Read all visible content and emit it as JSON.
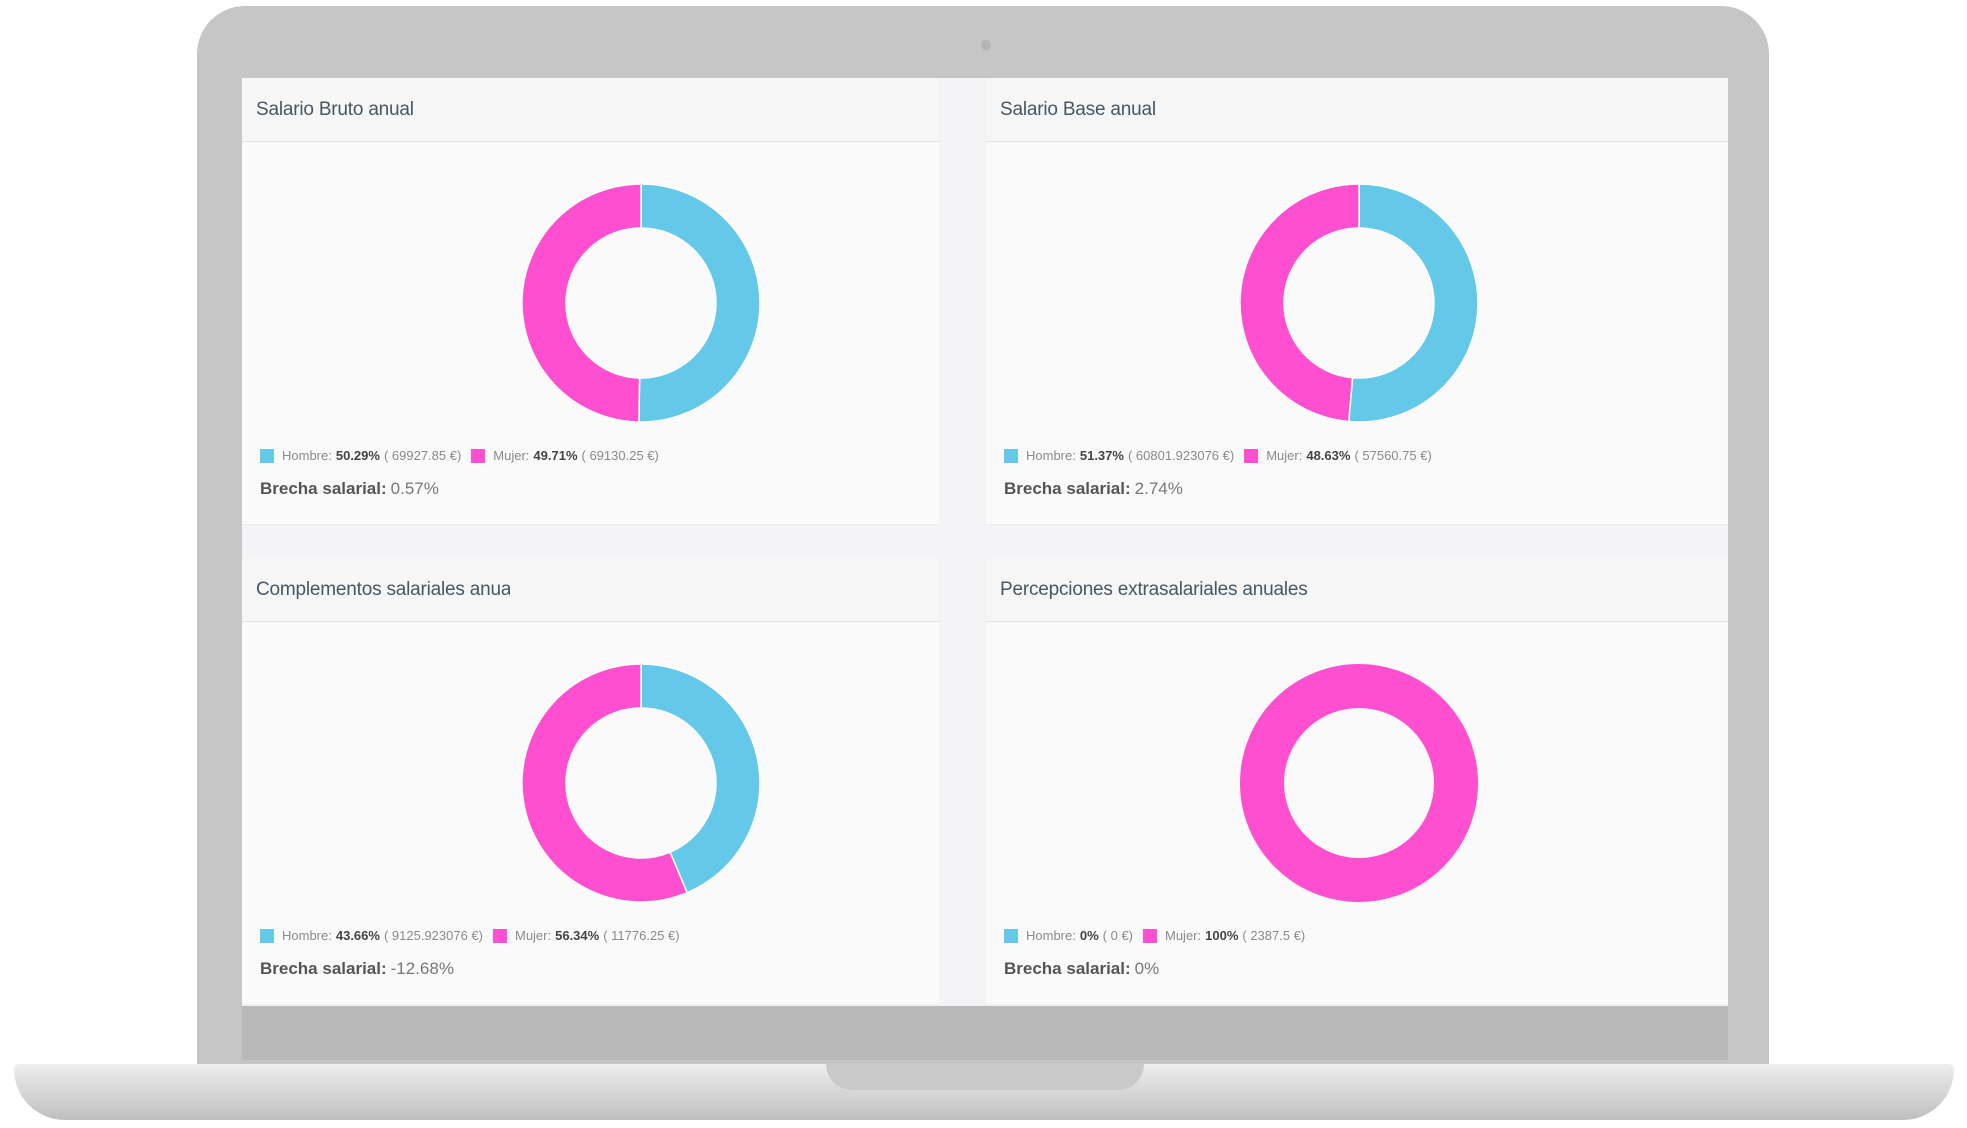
{
  "colors": {
    "hombre": "#64c8e8",
    "mujer": "#ff4fd1"
  },
  "cards": [
    {
      "title": "Salario Bruto anual",
      "legend": {
        "hombre_label": "Hombre:",
        "hombre_pct": "50.29%",
        "hombre_value": "( 69927.85 €)",
        "mujer_label": "Mujer:",
        "mujer_pct": "49.71%",
        "mujer_value": "( 69130.25 €)"
      },
      "gap_label": "Brecha salarial:",
      "gap_value": "0.57%"
    },
    {
      "title": "Salario Base anual",
      "legend": {
        "hombre_label": "Hombre:",
        "hombre_pct": "51.37%",
        "hombre_value": "( 60801.923076 €)",
        "mujer_label": "Mujer:",
        "mujer_pct": "48.63%",
        "mujer_value": "( 57560.75 €)"
      },
      "gap_label": "Brecha salarial:",
      "gap_value": "2.74%"
    },
    {
      "title": "Complementos salariales anuales",
      "legend": {
        "hombre_label": "Hombre:",
        "hombre_pct": "43.66%",
        "hombre_value": "( 9125.923076 €)",
        "mujer_label": "Mujer:",
        "mujer_pct": "56.34%",
        "mujer_value": "( 11776.25 €)"
      },
      "gap_label": "Brecha salarial:",
      "gap_value": "-12.68%"
    },
    {
      "title": "Percepciones extrasalariales anuales",
      "legend": {
        "hombre_label": "Hombre:",
        "hombre_pct": "0%",
        "hombre_value": "( 0 €)",
        "mujer_label": "Mujer:",
        "mujer_pct": "100%",
        "mujer_value": "( 2387.5 €)"
      },
      "gap_label": "Brecha salarial:",
      "gap_value": "0%"
    }
  ],
  "chart_data": [
    {
      "type": "pie",
      "title": "Salario Bruto anual",
      "categories": [
        "Hombre",
        "Mujer"
      ],
      "values": [
        50.29,
        49.71
      ],
      "colors": [
        "#64c8e8",
        "#ff4fd1"
      ]
    },
    {
      "type": "pie",
      "title": "Salario Base anual",
      "categories": [
        "Hombre",
        "Mujer"
      ],
      "values": [
        51.37,
        48.63
      ],
      "colors": [
        "#64c8e8",
        "#ff4fd1"
      ]
    },
    {
      "type": "pie",
      "title": "Complementos salariales anuales",
      "categories": [
        "Hombre",
        "Mujer"
      ],
      "values": [
        43.66,
        56.34
      ],
      "colors": [
        "#64c8e8",
        "#ff4fd1"
      ]
    },
    {
      "type": "pie",
      "title": "Percepciones extrasalariales anuales",
      "categories": [
        "Hombre",
        "Mujer"
      ],
      "values": [
        0,
        100
      ],
      "colors": [
        "#64c8e8",
        "#ff4fd1"
      ]
    }
  ]
}
